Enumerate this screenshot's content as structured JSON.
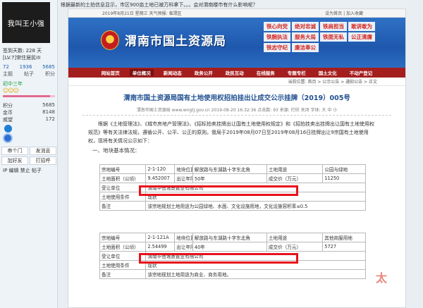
{
  "top_line": "根据最新的土拍信息显示，市区900亩土地已被万科拿下。。。会对渭南楼市有什么影响呢？",
  "profile": {
    "avatar_text": "我叫王小强",
    "signin_days": "签到天数: 228 天",
    "signin_level": "[LV.7]常住居民III",
    "stats": [
      {
        "value": "72",
        "label": "主题"
      },
      {
        "value": "1936",
        "label": "帖子"
      },
      {
        "value": "5685",
        "label": "积分"
      }
    ],
    "rank": "初中三年",
    "level_icons": "☺☺☺",
    "progress_fraction": 0.9,
    "fields": [
      {
        "key": "积分",
        "value": "5685"
      },
      {
        "key": "金币",
        "value": "8148"
      },
      {
        "key": "威望",
        "value": "172"
      }
    ],
    "buttons_row1": [
      "串个门",
      "发消息"
    ],
    "buttons_row2": [
      "加好友",
      "打招呼"
    ],
    "actions": "IP 编辑 禁止 帖子"
  },
  "site": {
    "top_bar_left": "2019年8月21日 星期三 天气预报: 临渭区",
    "top_bar_right": "设为首页 | 加入收藏",
    "bureau_name": "渭南市国土资源局",
    "slogans": [
      "铁心向党",
      "绝对忠诚",
      "铁肩担当",
      "敢讲敢为",
      "铁腕执法",
      "服务大局",
      "铁面无私",
      "公正清廉",
      "铁志守纪",
      "廉洁奉公"
    ],
    "nav": [
      "网站首页",
      "单位概况",
      "新闻动态",
      "政务公开",
      "政民互动",
      "在线服务",
      "专题专栏",
      "国土文化",
      "不动产登记"
    ],
    "breadcrumb": "当前位置: 首页 > 公示公告 > 通知公告 > 正文",
    "article_title": "渭南市国土资源局国有土地使用权招拍挂出让成交公示挂牌（2019）005号",
    "meta": "渭南市国土资源局 www.wngtj.gov.cn 2019-08-20 16:32:36 点击数: 93 来源: 打印 关闭 字体: 大 中 小",
    "paragraph": "根据《土地管理法》、《城市房地产管理法》、《招标拍卖挂牌出让国有土地使用权规定》和《招拍挂卖出挂牌出让国有土地使用权规范》等有关法律法规，遵循公开、公平、公正的原则。我局于2019年08月07日至2019年08月16日挂牌出让9宗国有土地使用权，现将有关情况公示如下：",
    "section": "一、地块基本情况：",
    "table1": [
      [
        "宗地编号",
        "2-1-120",
        "地块位置",
        "解放路与东湖路十字东北角",
        "土地用途",
        "公园与绿地"
      ],
      [
        "土地面积（公顷）",
        "9.452007",
        "出让年限",
        "50年",
        "成交价（万元）",
        "11250"
      ],
      [
        "受让单位",
        "渭南华岳逸景置业有限公司"
      ],
      [
        "土地使用条件",
        "现状"
      ],
      [
        "备注",
        "该宗地规划土地用途为公园绿地、水面、文化设施用地，文化设施容积率≤0.5"
      ]
    ],
    "table2": [
      [
        "宗地编号",
        "2-1-121A",
        "地块位置",
        "解放路与东湖路十字东北角",
        "土地用途",
        "其他商服用地"
      ],
      [
        "土地面积（公顷）",
        "2.54499",
        "出让年限",
        "40年",
        "成交价（万元）",
        "5727"
      ],
      [
        "受让单位",
        "渭南华岳逸景置业有限公司"
      ],
      [
        "土地使用条件",
        "现状"
      ],
      [
        "备注",
        "该宗地规划土地用途为商业、商务用地。"
      ]
    ],
    "watermark": "太"
  },
  "colors": {
    "nav_red": "#a51e1e",
    "banner_blue": "#2f71c6",
    "highlight_red": "#e8121c",
    "title_blue": "#1f4e8f"
  }
}
